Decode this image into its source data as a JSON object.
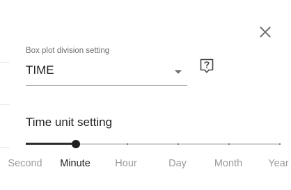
{
  "dialog": {
    "close_icon": "close-icon",
    "box_plot_division": {
      "label": "Box plot division setting",
      "value": "TIME",
      "help_icon": "help-question-icon"
    },
    "time_unit": {
      "title": "Time unit setting",
      "options": [
        "Second",
        "Minute",
        "Hour",
        "Day",
        "Month",
        "Year"
      ],
      "selected": "Minute",
      "selected_index": 1
    }
  }
}
